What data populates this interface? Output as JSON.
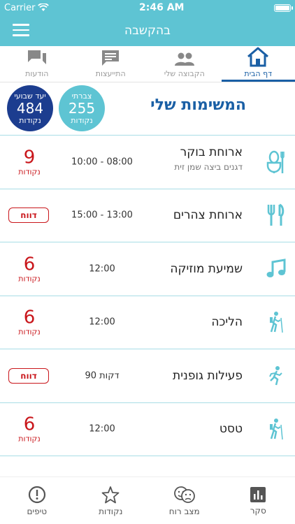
{
  "status_bar": {
    "carrier": "Carrier",
    "time": "2:46 AM"
  },
  "nav": {
    "title": "בהקשבה"
  },
  "top_tabs": [
    {
      "label": "דף הבית",
      "icon": "home-icon",
      "active": true
    },
    {
      "label": "הקבוצה שלי",
      "icon": "group-icon",
      "active": false
    },
    {
      "label": "התייעצות",
      "icon": "chat-icon",
      "active": false
    },
    {
      "label": "הודעות",
      "icon": "messages-icon",
      "active": false
    }
  ],
  "header": {
    "title": "המשימות שלי",
    "weekly": {
      "top": "יעד שבועי",
      "value": "484",
      "bottom": "נקודות"
    },
    "accumulated": {
      "top": "צברתי",
      "value": "255",
      "bottom": "נקודות"
    }
  },
  "tasks": [
    {
      "title": "ארוחת בוקר",
      "subtitle": "דגנים ביצה שמן זית",
      "time": "10:00 - 08:00",
      "points": "9",
      "points_label": "נקודות",
      "icon": "breakfast-icon"
    },
    {
      "title": "ארוחת צהרים",
      "time": "15:00 - 13:00",
      "report": "דווח",
      "icon": "lunch-icon"
    },
    {
      "title": "שמיעת מוזיקה",
      "time": "12:00",
      "points": "6",
      "points_label": "נקודות",
      "icon": "music-icon"
    },
    {
      "title": "הליכה",
      "time": "12:00",
      "points": "6",
      "points_label": "נקודות",
      "icon": "hiking-icon"
    },
    {
      "title": "פעילות גופנית",
      "time": "90 דקות",
      "report": "דווח",
      "icon": "running-icon"
    },
    {
      "title": "טסט",
      "time": "12:00",
      "points": "6",
      "points_label": "נקודות",
      "icon": "hiking-icon"
    }
  ],
  "bottom_tabs": [
    {
      "label": "סקר",
      "icon": "survey-icon"
    },
    {
      "label": "מצב רוח",
      "icon": "mood-icon"
    },
    {
      "label": "נקודות",
      "icon": "star-icon"
    },
    {
      "label": "טיפים",
      "icon": "tips-icon"
    }
  ],
  "colors": {
    "primary": "#5ec4d3",
    "dark_blue": "#1c3d8f",
    "accent_blue": "#1a5fa5",
    "red": "#c9161b"
  }
}
